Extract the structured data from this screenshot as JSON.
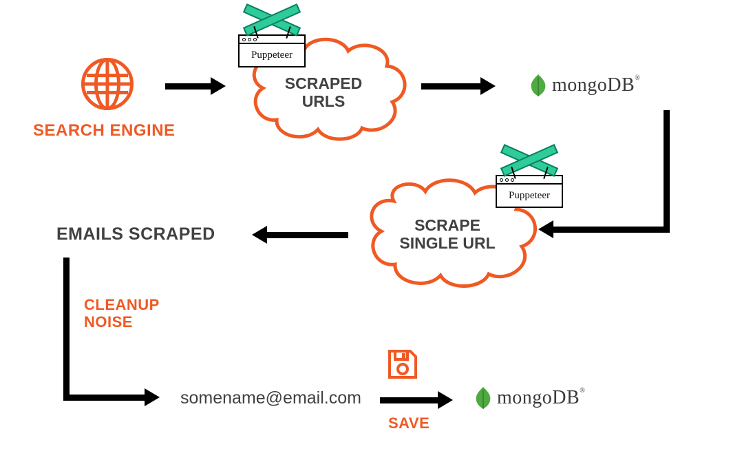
{
  "nodes": {
    "search_engine": {
      "label": "SEARCH ENGINE"
    },
    "scraped_urls": {
      "line1": "SCRAPED",
      "line2": "URLS",
      "tool": "Puppeteer"
    },
    "mongodb_top": {
      "label": "mongoDB"
    },
    "scrape_single": {
      "line1": "SCRAPE",
      "line2": "SINGLE URL",
      "tool": "Puppeteer"
    },
    "emails_scraped": {
      "label": "EMAILS SCRAPED"
    },
    "email_sample": {
      "label": "somename@email.com"
    },
    "mongodb_bottom": {
      "label": "mongoDB"
    }
  },
  "edges": {
    "cleanup_noise": {
      "line1": "CLEANUP",
      "line2": "NOISE"
    },
    "save": {
      "label": "SAVE"
    }
  },
  "colors": {
    "accent": "#ef5a24",
    "text": "#414042",
    "mongo_leaf": "#4faa41",
    "puppeteer_green": "#2ecb9b"
  }
}
